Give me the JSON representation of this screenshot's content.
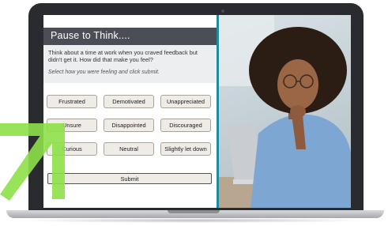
{
  "header": {
    "title": "Pause to Think...."
  },
  "question": {
    "text": "Think about a time at work when you craved feedback but didn't get it. How did that make you feel?",
    "instruction": "Select how you were feeling and click submit."
  },
  "options": [
    "Frustrated",
    "Demotivated",
    "Unappreciated",
    "Unsure",
    "Disappointed",
    "Discouraged",
    "Curious",
    "Neutral",
    "Slightly let down"
  ],
  "submit_label": "Submit",
  "colors": {
    "title_bar": "#4b4e55",
    "divider_accent": "#1f8aa0",
    "option_bg": "#efebe6",
    "arrow": "#8ee04a"
  }
}
